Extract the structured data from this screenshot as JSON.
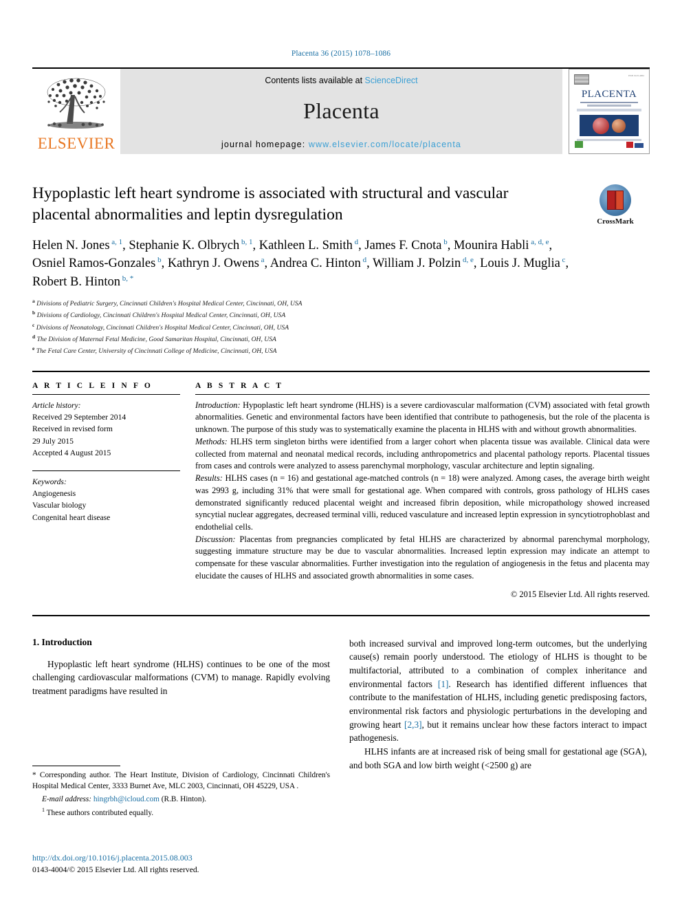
{
  "running_head": "Placenta 36 (2015) 1078–1086",
  "masthead": {
    "publisher_name": "ELSEVIER",
    "contents_prefix": "Contents lists available at ",
    "contents_link": "ScienceDirect",
    "journal_name": "Placenta",
    "homepage_prefix": "journal homepage: ",
    "homepage_url": "www.elsevier.com/locate/placenta",
    "cover": {
      "title": "PLACENTA",
      "issn_text": "ISSN 0143-4004",
      "caption": "An International Journal of Placental Biology"
    }
  },
  "article": {
    "title": "Hypoplastic left heart syndrome is associated with structural and vascular placental abnormalities and leptin dysregulation",
    "crossmark_label": "CrossMark",
    "authors": [
      {
        "name": "Helen N. Jones",
        "sup": "a, 1",
        "sep": ", "
      },
      {
        "name": "Stephanie K. Olbrych",
        "sup": "b, 1",
        "sep": ", "
      },
      {
        "name": "Kathleen L. Smith",
        "sup": "d",
        "sep": ", "
      },
      {
        "name": "James F. Cnota",
        "sup": "b",
        "sep": ", "
      },
      {
        "name": "Mounira Habli",
        "sup": "a, d, e",
        "sep": ", "
      },
      {
        "name": "Osniel Ramos-Gonzales",
        "sup": "b",
        "sep": ", "
      },
      {
        "name": "Kathryn J. Owens",
        "sup": "a",
        "sep": ", "
      },
      {
        "name": "Andrea C. Hinton",
        "sup": "d",
        "sep": ", "
      },
      {
        "name": "William J. Polzin",
        "sup": "d, e",
        "sep": ", "
      },
      {
        "name": "Louis J. Muglia",
        "sup": "c",
        "sep": ", "
      },
      {
        "name": "Robert B. Hinton",
        "sup": "b, *",
        "sep": ""
      }
    ],
    "affiliations": [
      {
        "mark": "a",
        "text": "Divisions of Pediatric Surgery, Cincinnati Children's Hospital Medical Center, Cincinnati, OH, USA"
      },
      {
        "mark": "b",
        "text": "Divisions of Cardiology, Cincinnati Children's Hospital Medical Center, Cincinnati, OH, USA"
      },
      {
        "mark": "c",
        "text": "Divisions of Neonatology, Cincinnati Children's Hospital Medical Center, Cincinnati, OH, USA"
      },
      {
        "mark": "d",
        "text": "The Division of Maternal Fetal Medicine, Good Samaritan Hospital, Cincinnati, OH, USA"
      },
      {
        "mark": "e",
        "text": "The Fetal Care Center, University of Cincinnati College of Medicine, Cincinnati, OH, USA"
      }
    ]
  },
  "article_info": {
    "heading": "A R T I C L E    I N F O",
    "history_label": "Article history:",
    "history": [
      "Received 29 September 2014",
      "Received in revised form",
      "29 July 2015",
      "Accepted 4 August 2015"
    ],
    "keywords_label": "Keywords:",
    "keywords": [
      "Angiogenesis",
      "Vascular biology",
      "Congenital heart disease"
    ]
  },
  "abstract": {
    "heading": "A B S T R A C T",
    "sections": [
      {
        "label": "Introduction:",
        "text": " Hypoplastic left heart syndrome (HLHS) is a severe cardiovascular malformation (CVM) associated with fetal growth abnormalities. Genetic and environmental factors have been identified that contribute to pathogenesis, but the role of the placenta is unknown. The purpose of this study was to systematically examine the placenta in HLHS with and without growth abnormalities."
      },
      {
        "label": "Methods:",
        "text": " HLHS term singleton births were identified from a larger cohort when placenta tissue was available. Clinical data were collected from maternal and neonatal medical records, including anthropometrics and placental pathology reports. Placental tissues from cases and controls were analyzed to assess parenchymal morphology, vascular architecture and leptin signaling."
      },
      {
        "label": "Results:",
        "text": " HLHS cases (n = 16) and gestational age-matched controls (n = 18) were analyzed. Among cases, the average birth weight was 2993 g, including 31% that were small for gestational age. When compared with controls, gross pathology of HLHS cases demonstrated significantly reduced placental weight and increased fibrin deposition, while micropathology showed increased syncytial nuclear aggregates, decreased terminal villi, reduced vasculature and increased leptin expression in syncytiotrophoblast and endothelial cells."
      },
      {
        "label": "Discussion:",
        "text": " Placentas from pregnancies complicated by fetal HLHS are characterized by abnormal parenchymal morphology, suggesting immature structure may be due to vascular abnormalities. Increased leptin expression may indicate an attempt to compensate for these vascular abnormalities. Further investigation into the regulation of angiogenesis in the fetus and placenta may elucidate the causes of HLHS and associated growth abnormalities in some cases."
      }
    ],
    "copyright": "© 2015 Elsevier Ltd. All rights reserved."
  },
  "body": {
    "section_number_title": "1. Introduction",
    "left_paragraph": "Hypoplastic left heart syndrome (HLHS) continues to be one of the most challenging cardiovascular malformations (CVM) to manage. Rapidly evolving treatment paradigms have resulted in",
    "right_paragraph_1a": "both increased survival and improved long-term outcomes, but the underlying cause(s) remain poorly understood. The etiology of HLHS is thought to be multifactorial, attributed to a combination of complex inheritance and environmental factors ",
    "right_ref_1": "[1]",
    "right_paragraph_1b": ". Research has identified different influences that contribute to the manifestation of HLHS, including genetic predisposing factors, environmental risk factors and physiologic perturbations in the developing and growing heart ",
    "right_ref_2": "[2,3]",
    "right_paragraph_1c": ", but it remains unclear how these factors interact to impact pathogenesis.",
    "right_paragraph_2": "HLHS infants are at increased risk of being small for gestational age (SGA), and both SGA and low birth weight (<2500 g) are"
  },
  "footnotes": {
    "corresponding": "* Corresponding author. The Heart Institute, Division of Cardiology, Cincinnati Children's Hospital Medical Center, 3333 Burnet Ave, MLC 2003, Cincinnati, OH 45229, USA .",
    "email_label": "E-mail address: ",
    "email": "hingrbh@icloud.com",
    "email_attrib": " (R.B. Hinton).",
    "equal_mark": "1",
    "equal_text": " These authors contributed equally.",
    "doi": "http://dx.doi.org/10.1016/j.placenta.2015.08.003",
    "issn_line": "0143-4004/© 2015 Elsevier Ltd. All rights reserved."
  },
  "colors": {
    "link_blue": "#1a6fa3",
    "sciencedirect_blue": "#3a9fd4",
    "elsevier_orange": "#E87722",
    "band_gray": "#e3e3e3"
  }
}
